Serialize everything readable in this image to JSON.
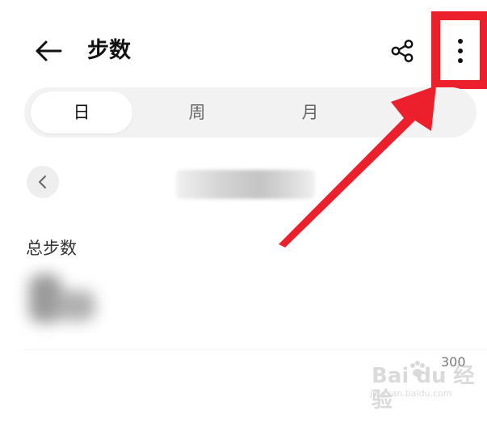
{
  "header": {
    "back_icon": "arrow-left-icon",
    "title": "步数",
    "share_icon": "share-icon",
    "more_icon": "more-vertical-icon"
  },
  "tabs": {
    "items": [
      {
        "label": "日",
        "selected": true
      },
      {
        "label": "周",
        "selected": false
      },
      {
        "label": "月",
        "selected": false
      }
    ]
  },
  "date_nav": {
    "prev_icon": "chevron-left-icon"
  },
  "summary": {
    "total_label": "总步数"
  },
  "chart": {
    "y_axis_tick": "300"
  },
  "watermark": {
    "text": "Bai du 经验",
    "url": "jingyan.baidu.com"
  },
  "colors": {
    "annotation_red": "#ec1f2c",
    "tab_background": "#f2f2f2",
    "selected_tab": "#ffffff"
  }
}
